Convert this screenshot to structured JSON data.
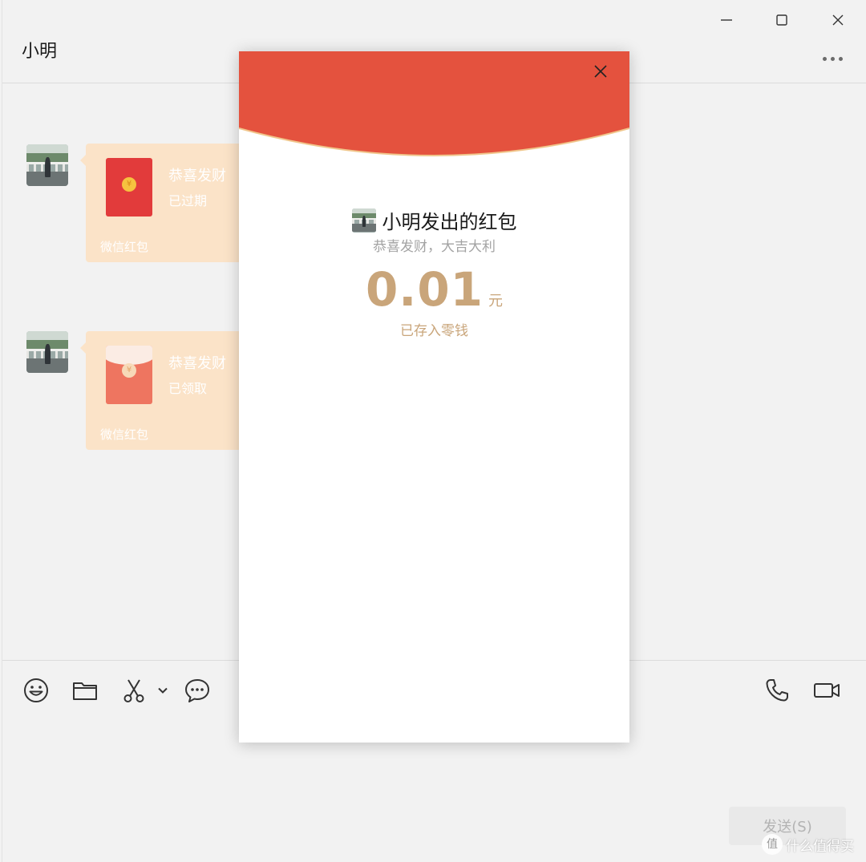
{
  "window": {
    "controls": [
      "minimize",
      "maximize",
      "close"
    ]
  },
  "chat": {
    "title": "小明"
  },
  "messages": [
    {
      "title": "恭喜发财",
      "status": "已过期",
      "footer": "微信红包",
      "envelope_state": "closed",
      "coin_symbol": "¥"
    },
    {
      "title": "恭喜发财",
      "status": "已领取",
      "footer": "微信红包",
      "envelope_state": "opened",
      "coin_symbol": "¥"
    }
  ],
  "toolbar": {
    "left_icons": [
      "emoji-icon",
      "folder-icon",
      "scissors-icon",
      "chevron-down-icon",
      "chat-bubble-icon"
    ],
    "right_icons": [
      "phone-icon",
      "video-icon"
    ],
    "send_label": "发送(S)"
  },
  "red_packet_dialog": {
    "sender_line": "小明发出的红包",
    "wish": "恭喜发财，大吉大利",
    "amount": "0.01",
    "unit": "元",
    "stored_label": "已存入零钱"
  },
  "watermark": {
    "badge": "值",
    "text": "什么值得买"
  },
  "colors": {
    "header_red": "#e4523e",
    "gold_text": "#c9a57a",
    "bubble_bg": "#fbe3c8",
    "envelope_red": "#e23b3b"
  }
}
